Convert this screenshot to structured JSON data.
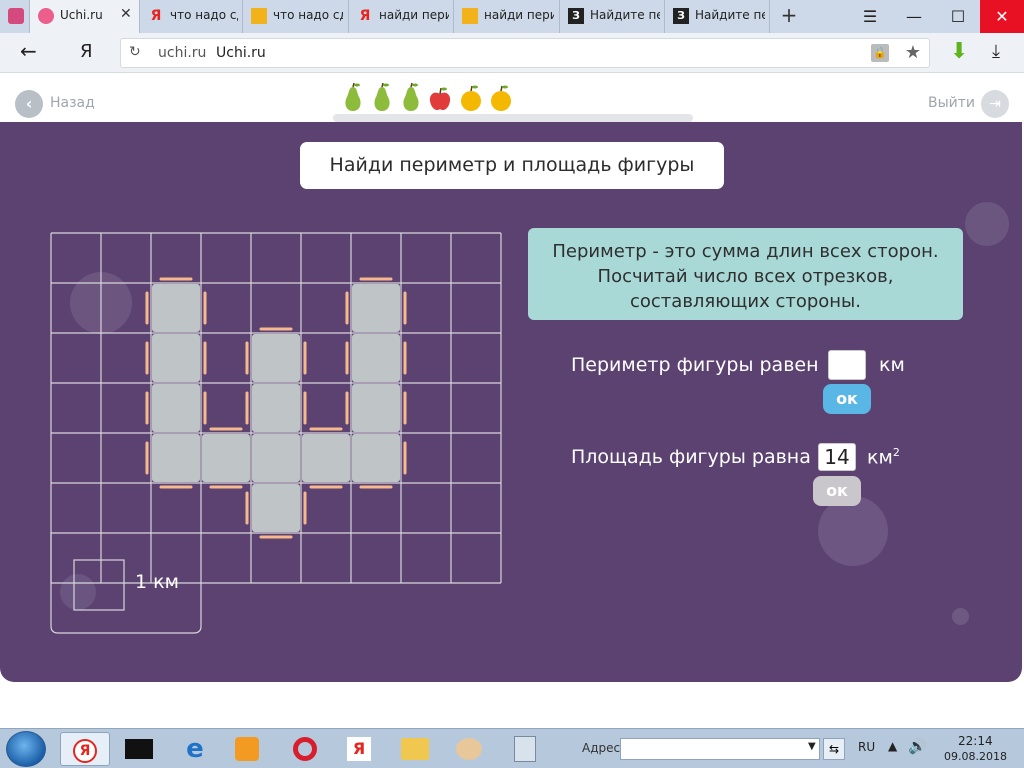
{
  "browser": {
    "tabs": [
      {
        "title": "",
        "favicon": "app-icon"
      },
      {
        "title": "Uchi.ru",
        "favicon": "uchi-icon",
        "active": true
      },
      {
        "title": "что надо сд",
        "favicon": "yandex-icon"
      },
      {
        "title": "что надо сд",
        "favicon": "image-icon"
      },
      {
        "title": "найди пери",
        "favicon": "yandex-icon"
      },
      {
        "title": "найди пери",
        "favicon": "image-icon"
      },
      {
        "title": "Найдите пе",
        "favicon": "znanija-icon"
      },
      {
        "title": "Найдите пе",
        "favicon": "znanija-icon"
      }
    ],
    "yandex_glyph": "Я",
    "znanija_glyph": "З",
    "address": {
      "domain": "uchi.ru",
      "title": "Uchi.ru"
    }
  },
  "header": {
    "back_label": "Назад",
    "exit_label": "Выйти",
    "fruits": [
      "pear",
      "pear",
      "pear",
      "apple",
      "orange",
      "orange"
    ],
    "fruit_colors": {
      "pear": "#8dbb3c",
      "apple": "#e23b3b",
      "orange": "#f5b800"
    }
  },
  "task": {
    "title": "Найди периметр и площадь фигуры",
    "hint_lines": [
      "Периметр - это сумма длин всех сторон.",
      "Посчитай число всех отрезков,",
      "составляющих стороны."
    ],
    "perimeter": {
      "label": "Периметр фигуры равен",
      "value": "",
      "unit": "км",
      "ok": "ок"
    },
    "area": {
      "label": "Площадь фигуры равна",
      "value": "14",
      "unit": "км",
      "unit_power": "2",
      "ok": "ок"
    },
    "scale_label": "1 км",
    "grid": {
      "cols": 9,
      "rows": 7
    },
    "figure_cells": [
      [
        2,
        1
      ],
      [
        2,
        2
      ],
      [
        2,
        3
      ],
      [
        2,
        4
      ],
      [
        3,
        4
      ],
      [
        4,
        2
      ],
      [
        4,
        3
      ],
      [
        4,
        4
      ],
      [
        4,
        5
      ],
      [
        5,
        4
      ],
      [
        6,
        1
      ],
      [
        6,
        2
      ],
      [
        6,
        3
      ],
      [
        6,
        4
      ]
    ],
    "colors": {
      "panel": "#5b4270",
      "grid_line": "#d8d6dc",
      "cell_fill": "#bfc4c7",
      "edge": "#f5b98c",
      "ok_active": "#5ab6e4"
    }
  },
  "taskbar": {
    "address_label": "Адрес",
    "lang": "RU",
    "time": "22:14",
    "date": "09.08.2018"
  }
}
